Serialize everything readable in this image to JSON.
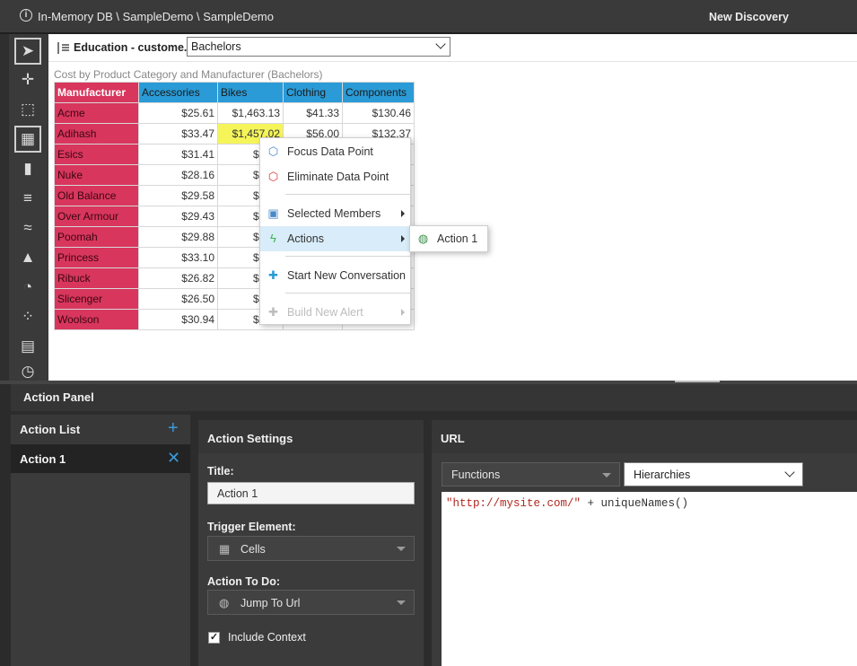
{
  "titlebar": {
    "path": "In-Memory DB \\ SampleDemo \\ SampleDemo",
    "new_discovery": "New Discovery"
  },
  "toolbar_icons": [
    "pointer-icon",
    "crosshair-icon",
    "selection-icon",
    "grid-icon",
    "column-chart-icon",
    "bar-chart-icon",
    "line-chart-icon",
    "area-chart-icon",
    "pie-chart-icon",
    "scatter-icon",
    "treemap-icon",
    "gauge-icon"
  ],
  "report": {
    "description": "Education - custome...",
    "filter_value": "Bachelors",
    "grid_title": "Cost by Product Category and Manufacturer (Bachelors)",
    "columns": [
      "Manufacturer",
      "Accessories",
      "Bikes",
      "Clothing",
      "Components"
    ],
    "rows": [
      {
        "name": "Acme",
        "accessories": "$25.61",
        "bikes": "$1,463.13",
        "clothing": "$41.33",
        "components": "$130.46"
      },
      {
        "name": "Adihash",
        "accessories": "$33.47",
        "bikes": "$1,457.02",
        "clothing": "$56.00",
        "components": "$132.37"
      },
      {
        "name": "Esics",
        "accessories": "$31.41",
        "bikes": "$1,34",
        "clothing": "",
        "components": ""
      },
      {
        "name": "Nuke",
        "accessories": "$28.16",
        "bikes": "$1,44",
        "clothing": "",
        "components": ""
      },
      {
        "name": "Old Balance",
        "accessories": "$29.58",
        "bikes": "$1,36",
        "clothing": "",
        "components": ""
      },
      {
        "name": "Over Armour",
        "accessories": "$29.43",
        "bikes": "$1,51",
        "clothing": "",
        "components": ""
      },
      {
        "name": "Poomah",
        "accessories": "$29.88",
        "bikes": "$1,42",
        "clothing": "",
        "components": ""
      },
      {
        "name": "Princess",
        "accessories": "$33.10",
        "bikes": "$1,57",
        "clothing": "",
        "components": ""
      },
      {
        "name": "Ribuck",
        "accessories": "$26.82",
        "bikes": "$1,39",
        "clothing": "",
        "components": ""
      },
      {
        "name": "Slicenger",
        "accessories": "$26.50",
        "bikes": "$1,53",
        "clothing": "",
        "components": ""
      },
      {
        "name": "Woolson",
        "accessories": "$30.94",
        "bikes": "$1,40",
        "clothing": "",
        "components": ""
      }
    ],
    "highlight_color": "#f5f55a",
    "header_color": "#2a9bd6",
    "rowhead_color": "#d8365d"
  },
  "context_menu": {
    "focus": "Focus Data Point",
    "eliminate": "Eliminate Data Point",
    "selected_members": "Selected Members",
    "actions": "Actions",
    "start_conversation": "Start New Conversation",
    "build_alert": "Build New Alert",
    "submenu_action": "Action 1"
  },
  "action_panel": {
    "title": "Action Panel",
    "list_header": "Action List",
    "list_items": [
      "Action 1"
    ],
    "settings_header": "Action Settings",
    "title_label": "Title:",
    "title_value": "Action 1",
    "trigger_label": "Trigger Element:",
    "trigger_value": "Cells",
    "action_label": "Action To Do:",
    "action_value": "Jump To Url",
    "include_context_label": "Include Context",
    "include_context_checked": true,
    "url_header": "URL",
    "functions_label": "Functions",
    "hierarchies_label": "Hierarchies",
    "url_string": "\"http://mysite.com/\"",
    "url_rest": " + uniqueNames()"
  },
  "accent_color": "#3a9bd8"
}
